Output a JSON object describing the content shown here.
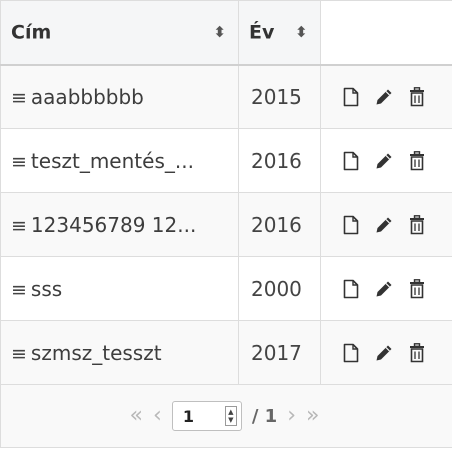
{
  "table": {
    "columns": [
      {
        "label": "Cím",
        "sortable": true
      },
      {
        "label": "Év",
        "sortable": true
      },
      {
        "label": "",
        "sortable": false
      }
    ],
    "rows": [
      {
        "title": "aaabbbbbb",
        "year": "2015"
      },
      {
        "title": "teszt_mentés_...",
        "year": "2016"
      },
      {
        "title": "123456789 12...",
        "year": "2016"
      },
      {
        "title": "sss",
        "year": "2000"
      },
      {
        "title": "szmsz_tesszt",
        "year": "2017"
      }
    ],
    "row_icons": [
      "drag-handle-icon",
      "document-icon",
      "pencil-icon",
      "trash-icon"
    ]
  },
  "pagination": {
    "first": "«",
    "prev": "‹",
    "current_page": "1",
    "of_total": "/ 1",
    "next": "›",
    "last": "»"
  },
  "icons": {
    "sort": "sort-icon"
  }
}
